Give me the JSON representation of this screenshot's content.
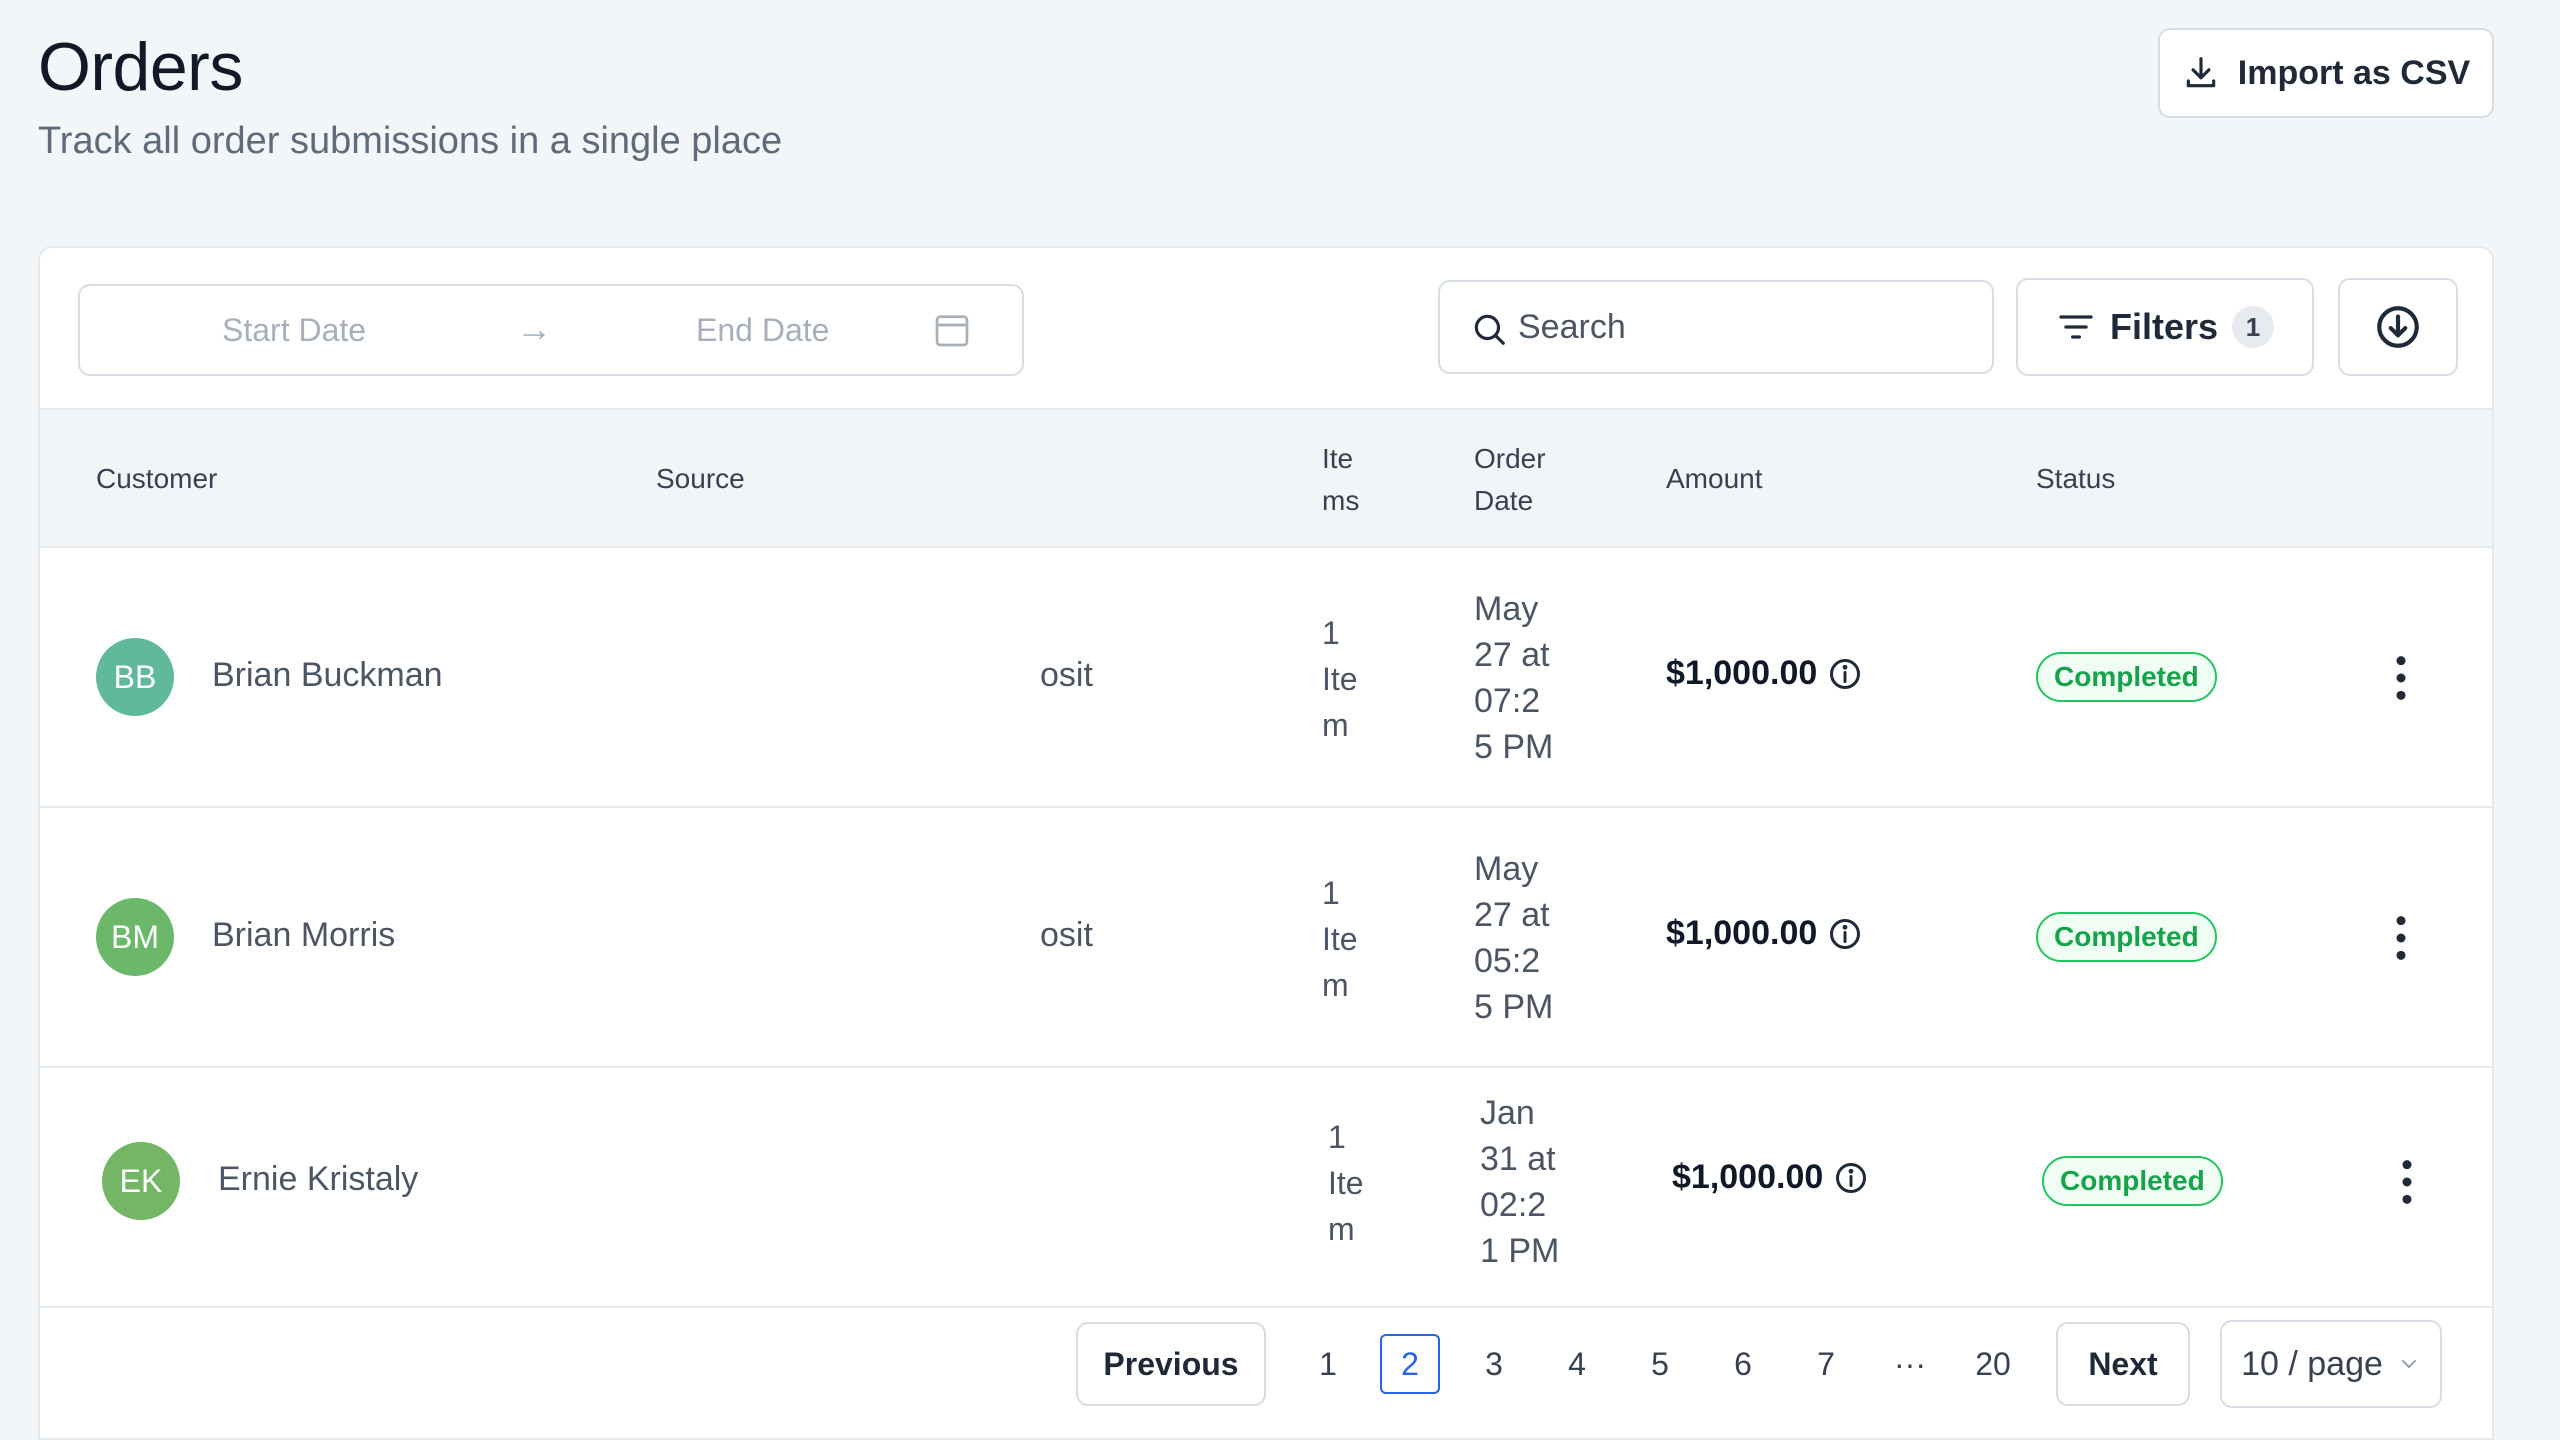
{
  "header": {
    "title": "Orders",
    "subtitle": "Track all order submissions in a single place",
    "import_label": "Import as CSV"
  },
  "toolbar": {
    "start_date_placeholder": "Start Date",
    "end_date_placeholder": "End Date",
    "range_arrow": "→",
    "search_placeholder": "Search",
    "filters_label": "Filters",
    "filters_count": "1"
  },
  "table": {
    "columns": {
      "customer": "Customer",
      "source": "Source",
      "items_l1": "Ite",
      "items_l2": "ms",
      "order_date_l1": "Order",
      "order_date_l2": "Date",
      "amount": "Amount",
      "status": "Status"
    },
    "rows": [
      {
        "initials": "BB",
        "avatar_color": "#5fb99a",
        "customer": "Brian Buckman",
        "source": "osit",
        "items": [
          "1",
          "Ite",
          "m"
        ],
        "date": [
          "May",
          "27 at",
          "07:2",
          "5 PM"
        ],
        "amount": "$1,000.00",
        "status": "Completed"
      },
      {
        "initials": "BM",
        "avatar_color": "#6bb86a",
        "customer": "Brian Morris",
        "source": "osit",
        "items": [
          "1",
          "Ite",
          "m"
        ],
        "date": [
          "May",
          "27 at",
          "05:2",
          "5 PM"
        ],
        "amount": "$1,000.00",
        "status": "Completed"
      },
      {
        "initials": "EK",
        "avatar_color": "#74b665",
        "customer": "Ernie Kristaly",
        "source": "",
        "items": [
          "1",
          "Ite",
          "m"
        ],
        "date": [
          "Jan",
          "31 at",
          "02:2",
          "1 PM"
        ],
        "amount": "$1,000.00",
        "status": "Completed"
      }
    ]
  },
  "pagination": {
    "previous": "Previous",
    "next": "Next",
    "pages": [
      "1",
      "2",
      "3",
      "4",
      "5",
      "6",
      "7",
      "···",
      "20"
    ],
    "active_page": "2",
    "page_size": "10 / page"
  },
  "colors": {
    "accent": "#2563eb",
    "status_green": "#16a34a"
  }
}
